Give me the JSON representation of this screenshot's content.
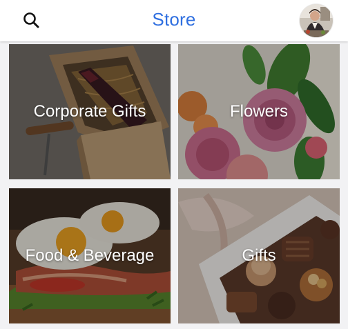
{
  "header": {
    "title": "Store",
    "search_icon": "search-icon",
    "avatar": "user-avatar"
  },
  "categories": [
    {
      "label": "Corporate Gifts"
    },
    {
      "label": "Flowers"
    },
    {
      "label": "Food & Beverage"
    },
    {
      "label": "Gifts"
    }
  ],
  "colors": {
    "accent": "#2f6fe0",
    "background": "#f2f2f4",
    "header_bg": "#ffffff"
  }
}
